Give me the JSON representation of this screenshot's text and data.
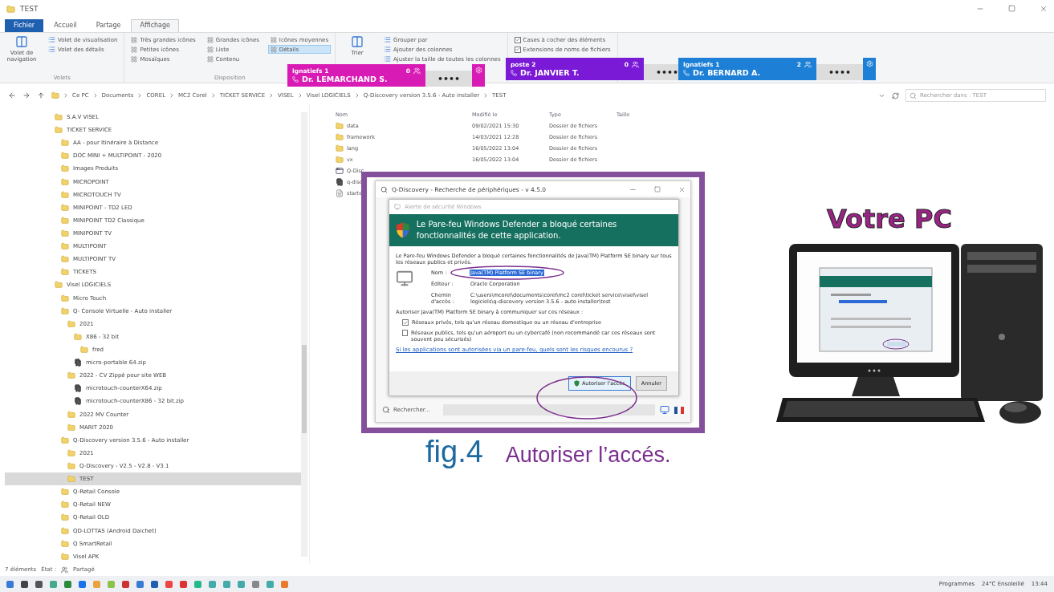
{
  "window": {
    "title": "TEST"
  },
  "ribbon": {
    "tabs": [
      {
        "label": "Fichier",
        "kind": "file",
        "selected": false
      },
      {
        "label": "Accueil",
        "kind": "tab",
        "selected": false
      },
      {
        "label": "Partage",
        "kind": "tab",
        "selected": false
      },
      {
        "label": "Affichage",
        "kind": "tab",
        "selected": true
      }
    ],
    "groups": [
      {
        "label": "Volets",
        "items": [
          {
            "kind": "large",
            "label": "Volet de navigation"
          },
          {
            "kind": "small",
            "label": "Volet de visualisation"
          },
          {
            "kind": "small",
            "label": "Volet des détails"
          }
        ]
      },
      {
        "label": "Disposition",
        "items": [
          {
            "kind": "option",
            "label": "Très grandes icônes",
            "selected": false
          },
          {
            "kind": "option",
            "label": "Grandes icônes",
            "selected": false
          },
          {
            "kind": "option",
            "label": "Icônes moyennes",
            "selected": false
          },
          {
            "kind": "option",
            "label": "Petites icônes",
            "selected": false
          },
          {
            "kind": "option",
            "label": "Liste",
            "selected": false
          },
          {
            "kind": "option",
            "label": "Détails",
            "selected": true
          },
          {
            "kind": "option",
            "label": "Mosaïques",
            "selected": false
          },
          {
            "kind": "option",
            "label": "Contenu",
            "selected": false
          }
        ]
      },
      {
        "items": [
          {
            "kind": "large",
            "label": "Trier"
          },
          {
            "kind": "small",
            "label": "Grouper par"
          },
          {
            "kind": "small",
            "label": "Ajouter des colonnes"
          },
          {
            "kind": "small",
            "label": "Ajuster la taille de toutes les colonnes"
          }
        ]
      },
      {
        "items": [
          {
            "kind": "check",
            "label": "Cases à cocher des éléments",
            "checked": true
          },
          {
            "kind": "check",
            "label": "Extensions de noms de fichiers",
            "checked": true
          }
        ]
      }
    ]
  },
  "call_widgets": [
    {
      "line": "Ignatiefs 1",
      "name": "Dr. LEMARCHAND S.",
      "count": "0",
      "dots": "••••",
      "color": "#d81bb4"
    },
    {
      "line": "poste 2",
      "name": "Dr. JANVIER T.",
      "count": "0",
      "dots": "••••",
      "color": "#7a19d6"
    },
    {
      "line": "Ignatiefs 1",
      "name": "Dr. BERNARD A.",
      "count": "2",
      "dots": "••••",
      "color": "#1d7fd6"
    }
  ],
  "address": {
    "crumbs": [
      "Ce PC",
      "Documents",
      "COREL",
      "MC2 Corel",
      "TICKET SERVICE",
      "VISEL",
      "Visel LOGICIELS",
      "Q-Discovery version 3.5.6 - Auto installer",
      "TEST"
    ],
    "search_placeholder": "Rechercher dans : TEST"
  },
  "tree": [
    {
      "label": "S.A.V VISEL",
      "kind": "folder",
      "selected": false
    },
    {
      "label": "TICKET SERVICE",
      "kind": "folder",
      "selected": false,
      "children": [
        {
          "label": "AA - pour Itinéraire à Distance",
          "kind": "folder",
          "selected": false
        },
        {
          "label": "DOC MINI + MULTIPOINT - 2020",
          "kind": "folder",
          "selected": false
        },
        {
          "label": "Images Produits",
          "kind": "folder",
          "selected": false
        },
        {
          "label": "MICROPOINT",
          "kind": "folder",
          "selected": false
        },
        {
          "label": "MICROTOUCH TV",
          "kind": "folder",
          "selected": false
        },
        {
          "label": "MINIPOINT - TD2 LED",
          "kind": "folder",
          "selected": false
        },
        {
          "label": "MINIPOINT TD2 Classique",
          "kind": "folder",
          "selected": false
        },
        {
          "label": "MINIPOINT TV",
          "kind": "folder",
          "selected": false
        },
        {
          "label": "MULTIPOINT",
          "kind": "folder",
          "selected": false
        },
        {
          "label": "MULTIPOINT TV",
          "kind": "folder",
          "selected": false
        },
        {
          "label": "TICKETS",
          "kind": "folder",
          "selected": false
        }
      ]
    },
    {
      "label": "Visel LOGICIELS",
      "kind": "folder",
      "selected": false,
      "children": [
        {
          "label": "Micro Touch",
          "kind": "folder",
          "selected": false
        },
        {
          "label": "Q- Console Virtuelle - Auto installer",
          "kind": "folder",
          "selected": false,
          "children": [
            {
              "label": "2021",
              "kind": "folder",
              "selected": false,
              "children": [
                {
                  "label": "X86 - 32 bit",
                  "kind": "folder",
                  "selected": false,
                  "children": [
                    {
                      "label": "fred",
                      "kind": "folder",
                      "selected": false
                    }
                  ]
                },
                {
                  "label": "micro-portable 64.zip",
                  "kind": "zip",
                  "selected": false
                }
              ]
            },
            {
              "label": "2022 - CV Zippé pour site WEB",
              "kind": "folder",
              "selected": false,
              "children": [
                {
                  "label": "microtouch-counterX64.zip",
                  "kind": "zip",
                  "selected": false
                },
                {
                  "label": "microtouch-counterX86 - 32 bit.zip",
                  "kind": "zip",
                  "selected": false
                }
              ]
            },
            {
              "label": "2022 MV Counter",
              "kind": "folder",
              "selected": false
            },
            {
              "label": "MARIT 2020",
              "kind": "folder",
              "selected": false
            }
          ]
        },
        {
          "label": "Q-Discovery version 3.5.6 - Auto installer",
          "kind": "folder",
          "selected": false,
          "children": [
            {
              "label": "2021",
              "kind": "folder",
              "selected": false
            },
            {
              "label": "Q-Discovery - V2.5 - V2.8 - V3.1",
              "kind": "folder",
              "selected": false
            },
            {
              "label": "TEST",
              "kind": "folder",
              "selected": true
            }
          ]
        },
        {
          "label": "Q-Retail Console",
          "kind": "folder",
          "selected": false
        },
        {
          "label": "Q-Retail NEW",
          "kind": "folder",
          "selected": false
        },
        {
          "label": "Q-Retail OLD",
          "kind": "folder",
          "selected": false
        },
        {
          "label": "QD-LOTTAS (Android Daichet)",
          "kind": "folder",
          "selected": false
        },
        {
          "label": "Q SmartRetail",
          "kind": "folder",
          "selected": false
        },
        {
          "label": "Visel APK",
          "kind": "folder",
          "selected": false
        }
      ]
    }
  ],
  "files": {
    "columns": [
      "Nom",
      "Modifié le",
      "Type",
      "Taille"
    ],
    "rows": [
      {
        "kind": "folder",
        "name": "data",
        "modified": "09/02/2021 15:30",
        "type": "Dossier de fichiers"
      },
      {
        "kind": "folder",
        "name": "framework",
        "modified": "14/03/2021 12:28",
        "type": "Dossier de fichiers"
      },
      {
        "kind": "folder",
        "name": "lang",
        "modified": "16/05/2022 13:04",
        "type": "Dossier de fichiers"
      },
      {
        "kind": "folder",
        "name": "vx",
        "modified": "16/05/2022 13:04",
        "type": "Dossier de fichiers"
      },
      {
        "kind": "app",
        "name": "Q-Disc"
      },
      {
        "kind": "zip",
        "name": "q-disc"
      },
      {
        "kind": "file",
        "name": "starte"
      }
    ]
  },
  "status_bar": {
    "count": "7 éléments",
    "state_label": "État :",
    "state": "Partagé"
  },
  "dialog": {
    "title": "Q-Discovery - Recherche de périphériques - v 4.5.0",
    "alert": {
      "title": "Alerte de sécurité Windows",
      "banner": "Le Pare-feu Windows Defender a bloqué certaines fonctionnalités de cette application.",
      "intro": "Le Pare-feu Windows Defender a bloqué certaines fonctionnalités de Java(TM) Platform SE binary sur tous les réseaux publics et privés.",
      "fields": [
        {
          "label": "Nom :",
          "value": "Java(TM) Platform SE binary",
          "kind": "highlight"
        },
        {
          "label": "Éditeur :",
          "value": "Oracle Corporation",
          "kind": "plain"
        },
        {
          "label": "Chemin d'accès :",
          "value": "C:\\users\\mcorel\\documents\\corel\\mc2 corel\\ticket service\\visel\\visel logiciels\\q-discovery version 3.5.6 - auto installer\\test",
          "kind": "plain"
        }
      ],
      "allow": "Autoriser Java(TM) Platform SE binary à communiquer sur ces réseaux :",
      "networks": [
        {
          "label": "Réseaux privés, tels qu'un réseau domestique ou un réseau d'entreprise",
          "checked": true
        },
        {
          "label": "Réseaux publics, tels qu'un aéroport ou un cybercafé (non recommandé car ces réseaux sont souvent peu sécurisés)",
          "checked": false
        }
      ],
      "link": "Si les applications sont autorisées via un pare-feu, quels sont les risques encourus ?",
      "buttons": [
        {
          "label": "Autoriser l'accès",
          "kind": "primary"
        },
        {
          "label": "Annuler",
          "kind": "plain"
        }
      ]
    },
    "search_placeholder": "Rechercher..."
  },
  "caption": {
    "figure": "fig.4",
    "text": "Autoriser l’accés."
  },
  "pc": {
    "title": "Votre PC"
  },
  "taskbar": {
    "programs": "Programmes",
    "weather": "24°C Ensoleillé",
    "time": "13:44"
  }
}
